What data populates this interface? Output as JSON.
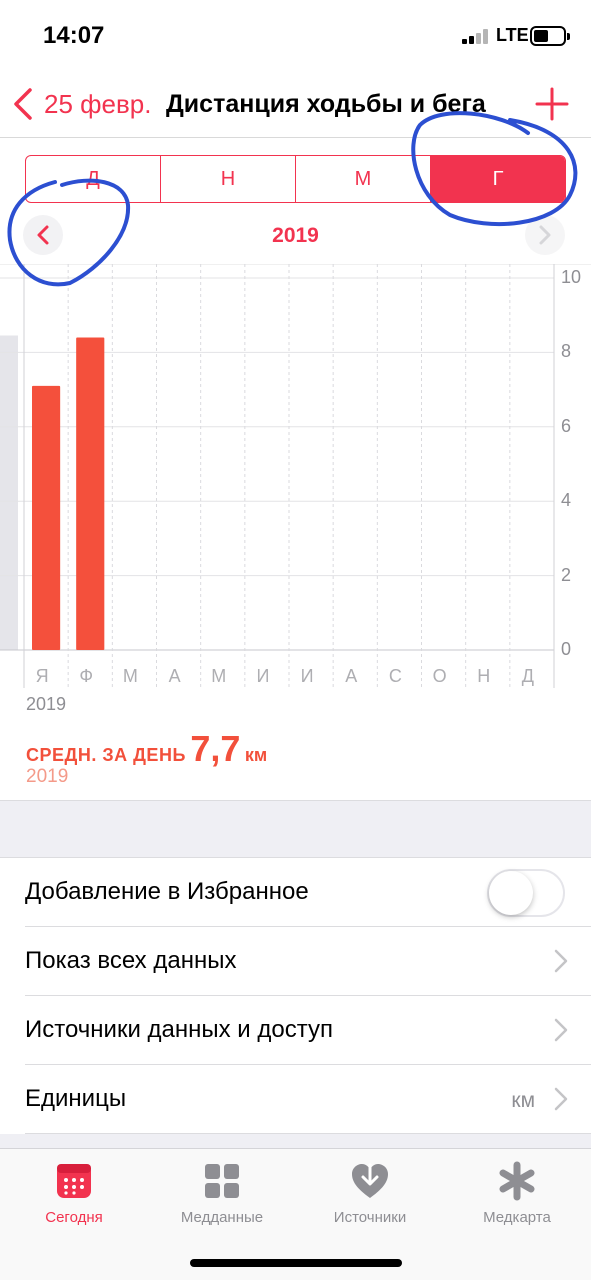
{
  "status_bar": {
    "time": "14:07",
    "network": "LTE"
  },
  "nav": {
    "back_label": "25 февр.",
    "title": "Дистанция ходьбы и бега"
  },
  "segments": [
    {
      "label": "Д",
      "selected": false
    },
    {
      "label": "Н",
      "selected": false
    },
    {
      "label": "М",
      "selected": false
    },
    {
      "label": "Г",
      "selected": true
    }
  ],
  "period": {
    "label": "2019"
  },
  "chart_data": {
    "type": "bar",
    "categories": [
      "Я",
      "Ф",
      "М",
      "А",
      "М",
      "И",
      "И",
      "А",
      "С",
      "О",
      "Н",
      "Д"
    ],
    "values": [
      7.1,
      8.4,
      null,
      null,
      null,
      null,
      null,
      null,
      null,
      null,
      null,
      null
    ],
    "y_ticks": [
      "10",
      "8",
      "6",
      "4",
      "2",
      "0"
    ],
    "ylim": [
      0,
      10
    ],
    "year_label": "2019",
    "bar_color": "#f4503c",
    "grid": true
  },
  "average": {
    "label": "СРЕДН. ЗА ДЕНЬ",
    "value": "7,7",
    "unit": "км",
    "period": "2019"
  },
  "settings": {
    "favorites_label": "Добавление в Избранное",
    "favorites_on": false,
    "show_all_label": "Показ всех данных",
    "sources_label": "Источники данных и доступ",
    "units_label": "Единицы",
    "units_value": "км"
  },
  "tabs": [
    {
      "label": "Сегодня",
      "icon": "calendar-icon",
      "active": true
    },
    {
      "label": "Медданные",
      "icon": "grid-icon",
      "active": false
    },
    {
      "label": "Источники",
      "icon": "heart-download-icon",
      "active": false
    },
    {
      "label": "Медкарта",
      "icon": "asterisk-icon",
      "active": false
    }
  ],
  "colors": {
    "accent": "#f2334f",
    "bar": "#f4503c",
    "annotation": "#2c4fd1"
  }
}
